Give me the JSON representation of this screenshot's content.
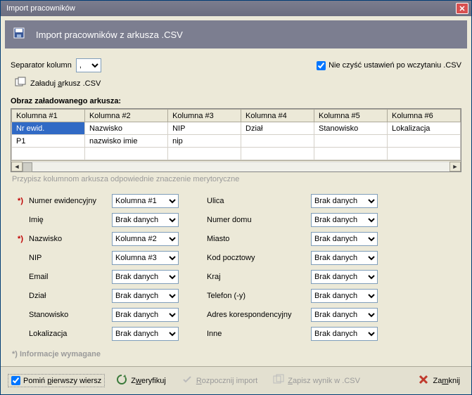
{
  "window": {
    "title": "Import pracowników"
  },
  "header": {
    "title": "Import pracowników z arkusza .CSV"
  },
  "controls": {
    "separator_label": "Separator kolumn",
    "separator_value": ",",
    "keep_settings_label": "Nie czyść ustawień po wczytaniu .CSV",
    "load_sheet_pre": "Załaduj ",
    "load_sheet_u": "a",
    "load_sheet_post": "rkusz .CSV"
  },
  "preview": {
    "title": "Obraz załadowanego arkusza:",
    "headers": [
      "Kolumna #1",
      "Kolumna #2",
      "Kolumna #3",
      "Kolumna #4",
      "Kolumna #5",
      "Kolumna #6"
    ],
    "rows": [
      [
        "Nr ewid.",
        "Nazwisko",
        "NIP",
        "Dział",
        "Stanowisko",
        "Lokalizacja"
      ],
      [
        "P1",
        "nazwisko imie",
        "nip",
        "",
        "",
        ""
      ]
    ],
    "hint": "Przypisz kolumnom arkusza odpowiednie znaczenie merytoryczne"
  },
  "mapping": {
    "star": "*)",
    "left": [
      {
        "label": "Numer ewidencyjny",
        "value": "Kolumna #1"
      },
      {
        "label": "Imię",
        "value": "Brak danych"
      },
      {
        "label": "Nazwisko",
        "value": "Kolumna #2"
      },
      {
        "label": "NIP",
        "value": "Kolumna #3"
      },
      {
        "label": "Email",
        "value": "Brak danych"
      },
      {
        "label": "Dział",
        "value": "Brak danych"
      },
      {
        "label": "Stanowisko",
        "value": "Brak danych"
      },
      {
        "label": "Lokalizacja",
        "value": "Brak danych"
      }
    ],
    "right": [
      {
        "label": "Ulica",
        "value": "Brak danych"
      },
      {
        "label": "Numer domu",
        "value": "Brak danych"
      },
      {
        "label": "Miasto",
        "value": "Brak danych"
      },
      {
        "label": "Kod pocztowy",
        "value": "Brak danych"
      },
      {
        "label": "Kraj",
        "value": "Brak danych"
      },
      {
        "label": "Telefon (-y)",
        "value": "Brak danych"
      },
      {
        "label": "Adres korespondencyjny",
        "value": "Brak danych"
      },
      {
        "label": "Inne",
        "value": "Brak danych"
      }
    ],
    "required_note": "*) Informacje wymagane"
  },
  "footer": {
    "skip_first_pre": "Pomiń ",
    "skip_first_u": "p",
    "skip_first_post": "ierwszy wiersz",
    "verify_pre": "Z",
    "verify_u": "w",
    "verify_post": "eryfikuj",
    "start_u": "R",
    "start_post": "ozpocznij import",
    "save_u": "Z",
    "save_post": "apisz wynik w .CSV",
    "close_pre": "Za",
    "close_u": "m",
    "close_post": "knij"
  }
}
